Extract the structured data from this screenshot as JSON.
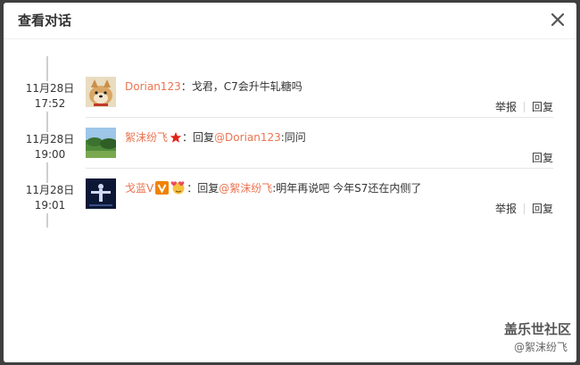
{
  "dialog": {
    "title": "查看对话",
    "close_symbol": "✕"
  },
  "entries": [
    {
      "date": "11月28日",
      "time": "17:52",
      "username": "Dorian123",
      "sep": "：",
      "text": "戈君，C7会升牛轧糖吗",
      "actions": [
        "举报",
        "回复"
      ]
    },
    {
      "date": "11月28日",
      "time": "19:00",
      "username": "絮沫纷飞",
      "badge_icon": "red-star-icon",
      "sep": "：",
      "reply_prefix": "回复",
      "mention": "@Dorian123",
      "text": ":同问",
      "actions": [
        "回复"
      ]
    },
    {
      "date": "11月28日",
      "time": "19:01",
      "username": "戈蓝V",
      "badge_icons": [
        "vip-v-icon",
        "heart-face-icon"
      ],
      "sep": "：",
      "reply_prefix": "回复",
      "mention": "@絮沫纷飞",
      "text": ":明年再说吧  今年S7还在内侧了",
      "actions": [
        "举报",
        "回复"
      ]
    }
  ],
  "watermark": {
    "line1": "盖乐世社区",
    "line2": "@絮沫纷飞"
  },
  "colors": {
    "accent": "#eb7350",
    "backdrop": "#3f3f3f"
  }
}
